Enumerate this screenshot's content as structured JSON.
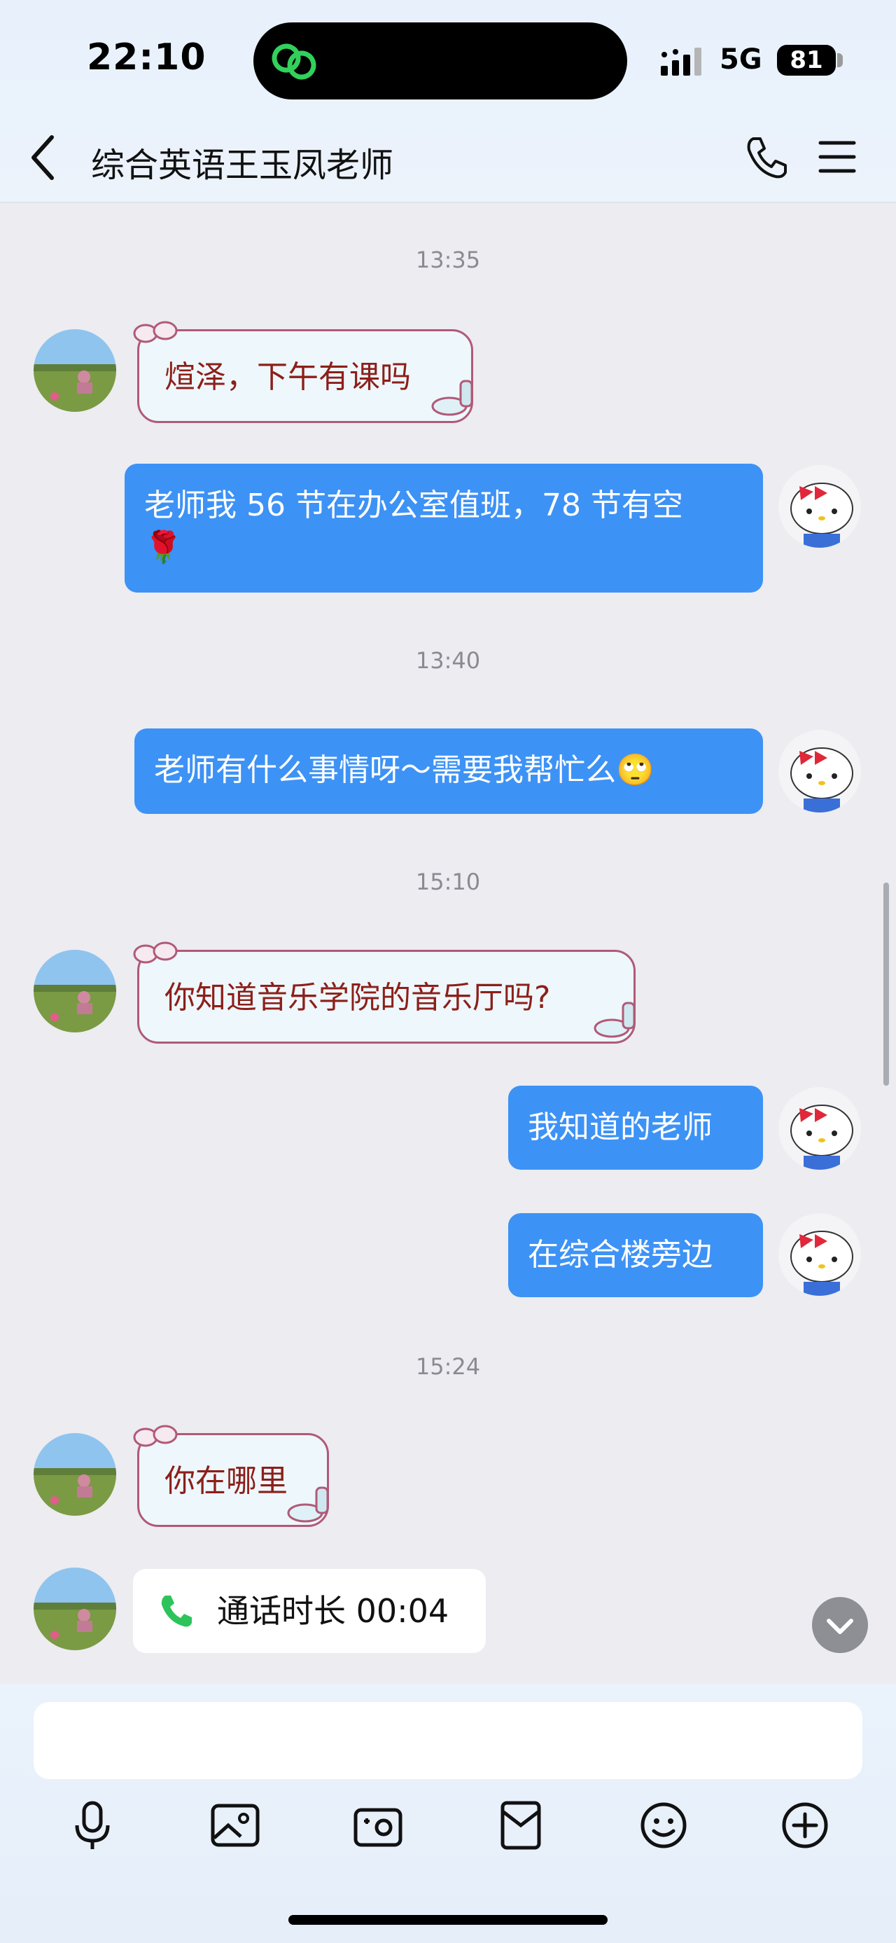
{
  "status_bar": {
    "time": "22:10",
    "network": "5G",
    "battery": "81"
  },
  "header": {
    "title": "综合英语王玉凤老师"
  },
  "messages": {
    "ts1": "13:35",
    "m1": "煊泽，下午有课吗",
    "m2_line1": "老师我 56 节在办公室值班，78 节有空",
    "m2_line2": "🌹",
    "ts2": "13:40",
    "m3": "老师有什么事情呀～需要我帮忙么",
    "m3_emoji": "🙄",
    "ts3": "15:10",
    "m4": "你知道音乐学院的音乐厅吗?",
    "m5": "我知道的老师",
    "m6": "在综合楼旁边",
    "ts4": "15:24",
    "m7": "你在哪里",
    "call": "通话时长 00:04"
  },
  "colors": {
    "outgoing": "#3d92f5",
    "incoming_text": "#8c1f1a",
    "call_icon": "#2cc45a"
  },
  "icons": [
    "back-chevron-icon",
    "phone-icon",
    "menu-icon",
    "mic-icon",
    "image-icon",
    "camera-icon",
    "red-packet-icon",
    "emoji-icon",
    "plus-icon"
  ]
}
